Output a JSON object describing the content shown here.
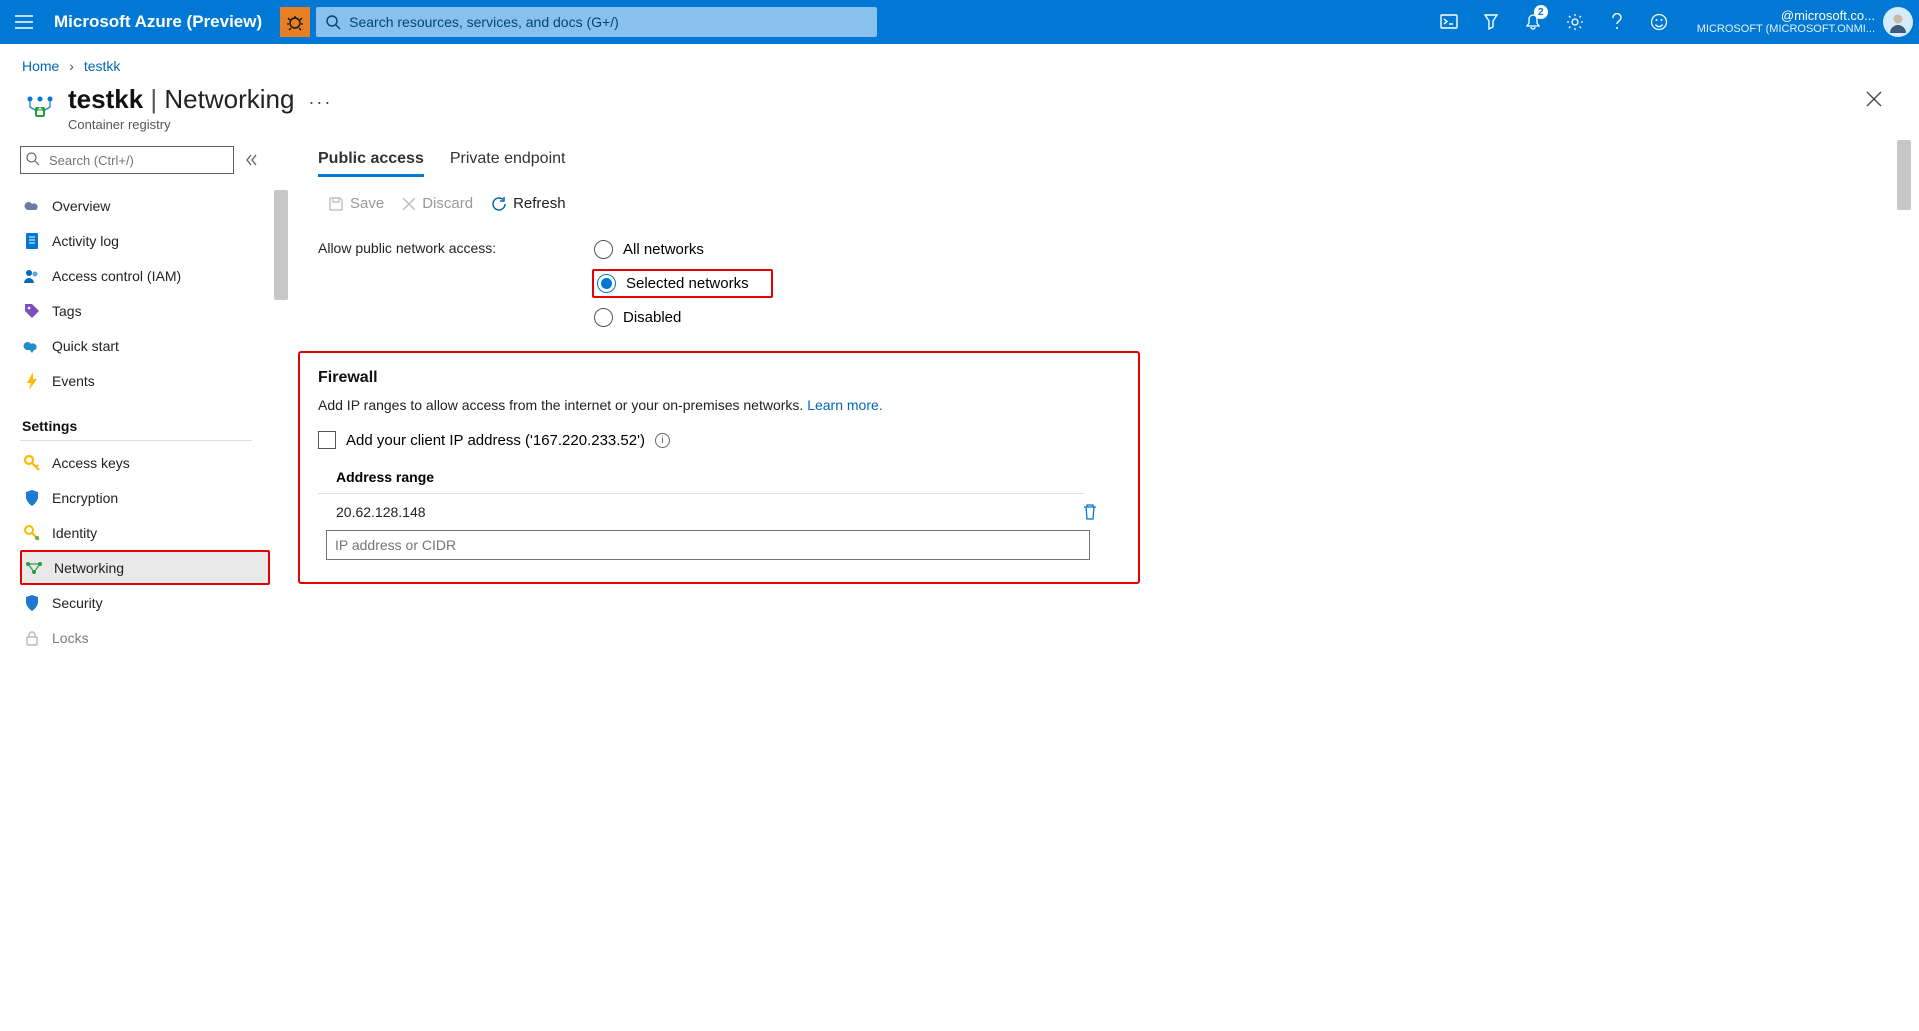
{
  "topbar": {
    "brand": "Microsoft Azure (Preview)",
    "search_placeholder": "Search resources, services, and docs (G+/)",
    "notification_count": "2",
    "account_line1": "@microsoft.co...",
    "account_line2": "MICROSOFT (MICROSOFT.ONMI..."
  },
  "breadcrumb": {
    "items": [
      "Home",
      "testkk"
    ]
  },
  "page": {
    "resource_name": "testkk",
    "page_name": "Networking",
    "resource_type": "Container registry"
  },
  "sidebar": {
    "search_placeholder": "Search (Ctrl+/)",
    "items_top": [
      {
        "icon": "cloud-icon",
        "label": "Overview",
        "color": "#6b7ca3"
      },
      {
        "icon": "log-icon",
        "label": "Activity log",
        "color": "#0078d4"
      },
      {
        "icon": "iam-icon",
        "label": "Access control (IAM)",
        "color": "#006abf"
      },
      {
        "icon": "tag-icon",
        "label": "Tags",
        "color": "#7a4fbf"
      },
      {
        "icon": "quickstart-icon",
        "label": "Quick start",
        "color": "#1f8ecd"
      },
      {
        "icon": "events-icon",
        "label": "Events",
        "color": "#ffb900"
      }
    ],
    "sections": [
      {
        "title": "Settings",
        "items": [
          {
            "icon": "key-icon",
            "label": "Access keys",
            "color": "#ffb900"
          },
          {
            "icon": "shield-icon",
            "label": "Encryption",
            "color": "#1f78d1"
          },
          {
            "icon": "identity-icon",
            "label": "Identity",
            "color": "#ffb900"
          },
          {
            "icon": "network-icon",
            "label": "Networking",
            "color": "#2a9d3e",
            "selected": true,
            "highlight": true
          },
          {
            "icon": "shield-icon",
            "label": "Security",
            "color": "#1f78d1"
          },
          {
            "icon": "lock-icon",
            "label": "Locks",
            "color": "#999",
            "truncated": true
          }
        ]
      }
    ]
  },
  "main": {
    "tabs": [
      {
        "label": "Public access",
        "active": true
      },
      {
        "label": "Private endpoint",
        "active": false
      }
    ],
    "toolbar": {
      "save": "Save",
      "discard": "Discard",
      "refresh": "Refresh"
    },
    "access_label": "Allow public network access:",
    "access_options": [
      {
        "label": "All networks",
        "checked": false
      },
      {
        "label": "Selected networks",
        "checked": true,
        "highlight": true
      },
      {
        "label": "Disabled",
        "checked": false
      }
    ],
    "firewall": {
      "title": "Firewall",
      "desc": "Add IP ranges to allow access from the internet or your on-premises networks. ",
      "learn_more": "Learn more.",
      "client_ip_label": "Add your client IP address ('167.220.233.52')",
      "addr_header": "Address range",
      "rows": [
        "20.62.128.148"
      ],
      "input_placeholder": "IP address or CIDR"
    }
  }
}
